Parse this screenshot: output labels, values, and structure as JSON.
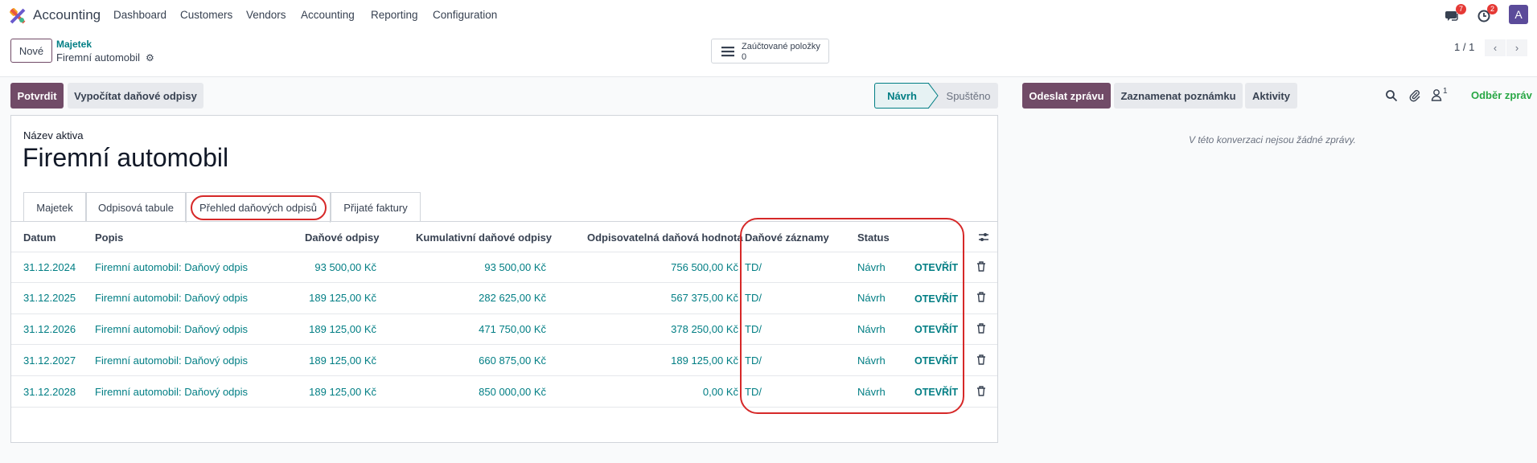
{
  "app": {
    "name": "Accounting"
  },
  "topnav": {
    "items": [
      "Dashboard",
      "Customers",
      "Vendors",
      "Accounting",
      "Reporting",
      "Configuration"
    ],
    "messages_count": "7",
    "activities_count": "2",
    "avatar_letter": "A"
  },
  "control": {
    "new_label": "Nové",
    "breadcrumb_parent": "Majetek",
    "breadcrumb_current": "Firemní automobil",
    "smart_button_label": "Zaúčtované položky",
    "smart_button_count": "0",
    "pager": "1 / 1"
  },
  "actions": {
    "confirm": "Potvrdit",
    "compute": "Vypočítat daňové odpisy"
  },
  "statusbar": {
    "active": "Návrh",
    "next": "Spuštěno"
  },
  "form": {
    "field_label": "Název aktiva",
    "asset_name": "Firemní automobil",
    "tabs": [
      "Majetek",
      "Odpisová tabule",
      "Přehled daňových odpisů",
      "Přijaté faktury"
    ],
    "active_tab": "Přehled daňových odpisů"
  },
  "table": {
    "headers": {
      "date": "Datum",
      "description": "Popis",
      "tax_depreciation": "Daňové odpisy",
      "cumulative": "Kumulativní daňové odpisy",
      "depreciable": "Odpisovatelná daňová hodnota",
      "entries": "Daňové záznamy",
      "status": "Status"
    },
    "rows": [
      {
        "date": "31.12.2024",
        "description": "Firemní automobil: Daňový odpis",
        "tax": "93 500,00 Kč",
        "cumulative": "93 500,00 Kč",
        "depreciable": "756 500,00 Kč",
        "entries": "TD/",
        "status": "Návrh",
        "open": "OTEVŘÍT"
      },
      {
        "date": "31.12.2025",
        "description": "Firemní automobil: Daňový odpis",
        "tax": "189 125,00 Kč",
        "cumulative": "282 625,00 Kč",
        "depreciable": "567 375,00 Kč",
        "entries": "TD/",
        "status": "Návrh",
        "open": "OTEVŘÍT"
      },
      {
        "date": "31.12.2026",
        "description": "Firemní automobil: Daňový odpis",
        "tax": "189 125,00 Kč",
        "cumulative": "471 750,00 Kč",
        "depreciable": "378 250,00 Kč",
        "entries": "TD/",
        "status": "Návrh",
        "open": "OTEVŘÍT"
      },
      {
        "date": "31.12.2027",
        "description": "Firemní automobil: Daňový odpis",
        "tax": "189 125,00 Kč",
        "cumulative": "660 875,00 Kč",
        "depreciable": "189 125,00 Kč",
        "entries": "TD/",
        "status": "Návrh",
        "open": "OTEVŘÍT"
      },
      {
        "date": "31.12.2028",
        "description": "Firemní automobil: Daňový odpis",
        "tax": "189 125,00 Kč",
        "cumulative": "850 000,00 Kč",
        "depreciable": "0,00 Kč",
        "entries": "TD/",
        "status": "Návrh",
        "open": "OTEVŘÍT"
      }
    ]
  },
  "chatter": {
    "send_message": "Odeslat zprávu",
    "log_note": "Zaznamenat poznámku",
    "activities": "Aktivity",
    "followers_count": "1",
    "follow": "Odběr zpráv",
    "empty": "V této konverzaci nejsou žádné zprávy."
  },
  "colors": {
    "primary": "#714b67",
    "link": "#017e84",
    "highlight": "#d62828",
    "follow": "#28a745"
  }
}
